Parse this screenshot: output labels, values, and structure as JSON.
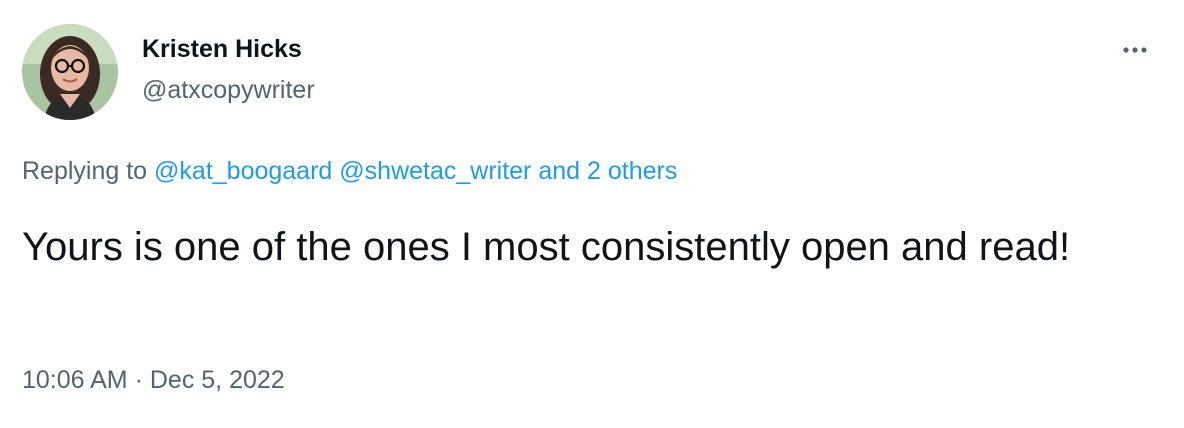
{
  "author": {
    "name": "Kristen Hicks",
    "handle": "@atxcopywriter"
  },
  "menu_icon": "more-options-icon",
  "reply_context": {
    "prefix": "Replying to",
    "mentions": [
      "@kat_boogaard",
      "@shwetac_writer"
    ],
    "others": "and 2 others"
  },
  "tweet_text": "Yours is one of the ones I most consistently open and read!",
  "timestamp": {
    "time": "10:06 AM",
    "separator": "·",
    "date": "Dec 5, 2022"
  },
  "colors": {
    "text_primary": "#0f1419",
    "text_secondary": "#536471",
    "link": "#1d9bf0"
  }
}
